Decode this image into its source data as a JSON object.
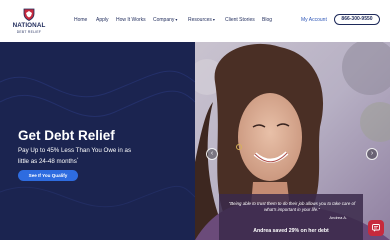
{
  "brand": {
    "name": "NATIONAL",
    "sub": "DEBT RELIEF"
  },
  "nav": {
    "items": [
      {
        "label": "Home"
      },
      {
        "label": "Apply"
      },
      {
        "label": "How It Works"
      },
      {
        "label": "Company",
        "dropdown": true
      },
      {
        "label": "Resources",
        "dropdown": true
      },
      {
        "label": "Client Stories"
      },
      {
        "label": "Blog"
      }
    ],
    "account": "My Account",
    "phone": "866-300-9550"
  },
  "hero": {
    "title": "Get Debt Relief",
    "subtitle_main": "Pay Up to 45% Less Than You Owe in as little as 24-48 months",
    "subtitle_mark": "*",
    "cta": "See If You Qualify",
    "arrow_prev": "‹",
    "arrow_next": "›"
  },
  "testimonial": {
    "quote": "“Being able to trust them to do their job allows you to take care of what’s important in your life.”",
    "author": "Andrea A.",
    "result": "Andrea saved 29% on her debt"
  },
  "colors": {
    "navy": "#1b2450",
    "accent_blue": "#2e6ce0",
    "brand_red": "#c72a3d"
  },
  "icons": {
    "logo": "shield-eagle-icon",
    "dropdown": "chevron-down-icon",
    "chat": "chat-icon"
  }
}
